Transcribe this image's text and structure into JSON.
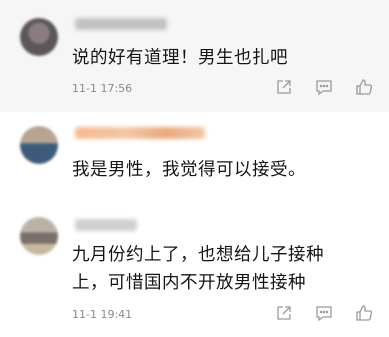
{
  "comments": [
    {
      "text_lines": [
        "说的好有道理！男生也扎吧"
      ],
      "timestamp": "11-1 17:56",
      "actions": [
        "share-icon",
        "comment-icon",
        "like-icon"
      ]
    },
    {
      "text_lines": [
        "我是男性，我觉得可以接受。"
      ]
    },
    {
      "text_lines": [
        "九月份约上了，也想给儿子接种",
        "上，可惜国内不开放男性接种"
      ],
      "timestamp": "11-1 19:41",
      "actions": [
        "share-icon",
        "comment-icon",
        "like-icon"
      ]
    }
  ],
  "colors": {
    "text": "#141414",
    "meta": "#8a8a8a",
    "icon": "#9a9a9a",
    "highlight_bg": "#f6f6f6"
  }
}
